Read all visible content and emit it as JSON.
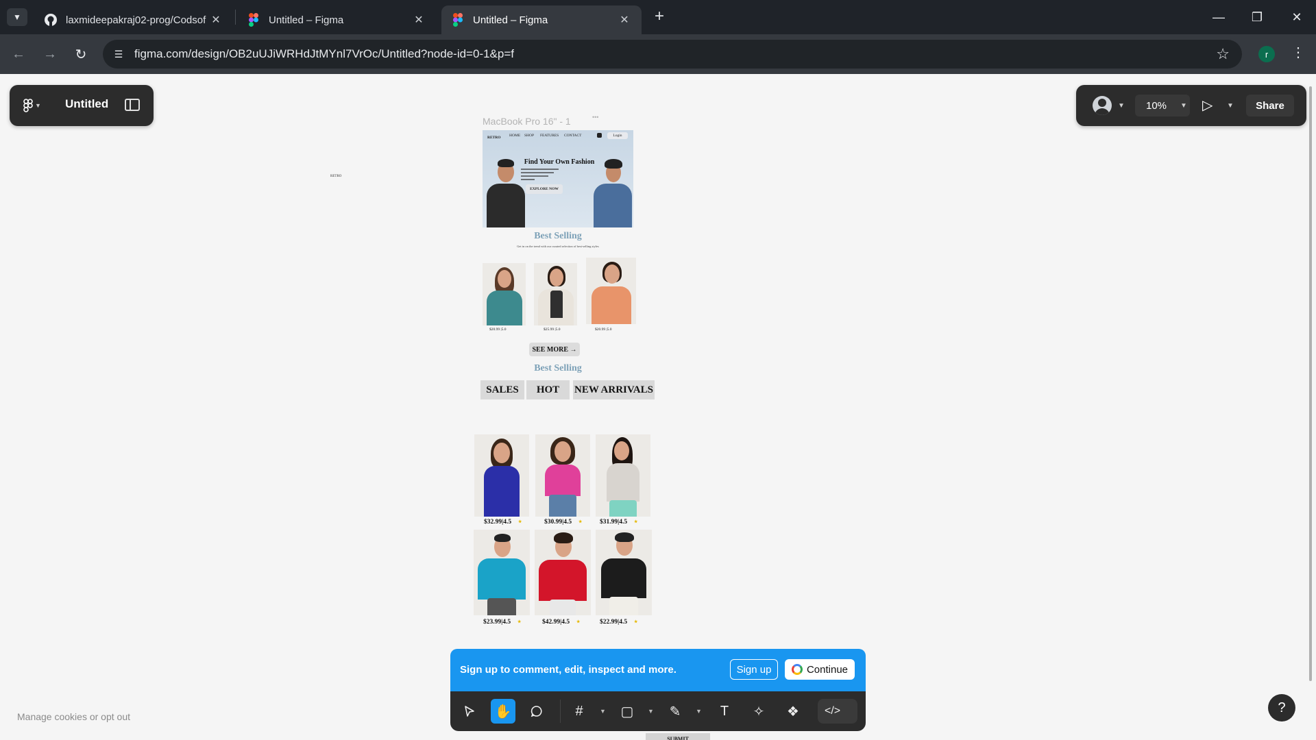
{
  "browser": {
    "tabs": [
      {
        "title": "laxmideepakraj02-prog/Codsof",
        "icon": "github-icon"
      },
      {
        "title": "Untitled – Figma",
        "icon": "figma-icon"
      },
      {
        "title": "Untitled – Figma",
        "icon": "figma-icon",
        "active": true
      }
    ],
    "url": "figma.com/design/OB2uUJiWRHdJtMYnl7VrOc/Untitled?node-id=0-1&p=f",
    "profile_initial": "r"
  },
  "figma": {
    "file_name": "Untitled",
    "zoom": "10%",
    "share_label": "Share",
    "frame_label": "MacBook Pro 16\" - 1",
    "stray_text": "RETRO",
    "cookies_text": "Manage cookies or opt out",
    "help_label": "?"
  },
  "design": {
    "nav": {
      "brand": "RETRO",
      "links": [
        "HOME",
        "SHOP",
        "FEATURES",
        "CONTACT"
      ],
      "login": "Login"
    },
    "hero": {
      "title": "Find Your Own Fashion",
      "button": "EXPLORE NOW"
    },
    "best_selling": {
      "title": "Best Selling",
      "subtitle": "Get in on the trend with our curated selection of best-selling styles",
      "prices": [
        "$20.99 |5.0",
        "$25.99 |5.0",
        "$20.99 |5.0"
      ],
      "see_more": "SEE MORE →"
    },
    "best_selling_2": {
      "title": "Best Selling",
      "tabs": [
        "SALES",
        "HOT",
        "NEW ARRIVALS"
      ],
      "prices": [
        "$32.99|4.5",
        "$30.99|4.5",
        "$31.99|4.5",
        "$23.99|4.5",
        "$42.99|4.5",
        "$22.99|4.5"
      ],
      "star": "★"
    },
    "submit": "SUBMIT"
  },
  "signup": {
    "message": "Sign up to comment, edit, inspect and more.",
    "signup_label": "Sign up",
    "continue_label": "Continue"
  }
}
